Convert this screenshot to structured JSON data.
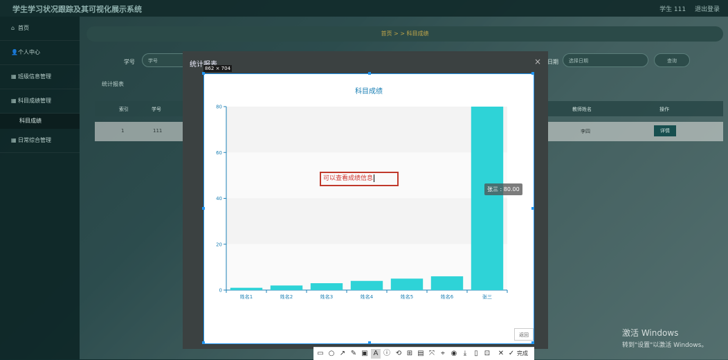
{
  "app": {
    "title": "学生学习状况跟踪及其可视化展示系统",
    "user": "学生 111",
    "logout": "退出登录"
  },
  "sidebar": {
    "items": [
      {
        "icon": "⌂",
        "label": "首页"
      },
      {
        "icon": "👤",
        "label": "个人中心"
      },
      {
        "icon": "▦",
        "label": "班级信息管理"
      },
      {
        "icon": "▦",
        "label": "科目成绩管理"
      }
    ],
    "sub_item": "科目成绩",
    "last_item": {
      "icon": "▦",
      "label": "日常综合管理"
    }
  },
  "breadcrumb": "首页 > > 科目成绩",
  "filters": {
    "student_no_label": "学号",
    "student_no_placeholder": "学号",
    "date_label": "日期",
    "date_placeholder": "选择日期",
    "search_button": "查询"
  },
  "stat_link": "统计报表",
  "table": {
    "headers": [
      "索引",
      "学号",
      "教师姓名",
      "操作"
    ],
    "row": {
      "index": "1",
      "student_no": "111",
      "teacher_name": "李四",
      "action": "详情"
    }
  },
  "modal": {
    "title": "统计报表",
    "close": "×",
    "back_button": "返回"
  },
  "screenshot_tool": {
    "size_label": "862 × 704",
    "tools": [
      "▭",
      "○",
      "↗",
      "✎",
      "▣",
      "A",
      "ⓘ",
      "⟲",
      "⊞",
      "▤",
      "⤧",
      "⌖",
      "◉",
      "⤓",
      "▯",
      "⊡",
      "✕",
      "✓"
    ],
    "done_label": "完成"
  },
  "annotation": "可以查看成绩信息",
  "chart_data": {
    "type": "bar",
    "title": "科目成绩",
    "categories": [
      "姓名1",
      "姓名2",
      "姓名3",
      "姓名4",
      "姓名5",
      "姓名6",
      "张三"
    ],
    "values": [
      1,
      2,
      3,
      4,
      5,
      6,
      80
    ],
    "ylim": [
      0,
      80
    ],
    "yticks": [
      0,
      20,
      40,
      60,
      80
    ],
    "tooltip": "张三 : 80.00",
    "bar_color": "#2ed3d7",
    "axis_color": "#1a7fb4"
  },
  "watermark": {
    "line1": "激活 Windows",
    "line2": "转到\"设置\"以激活 Windows。"
  }
}
